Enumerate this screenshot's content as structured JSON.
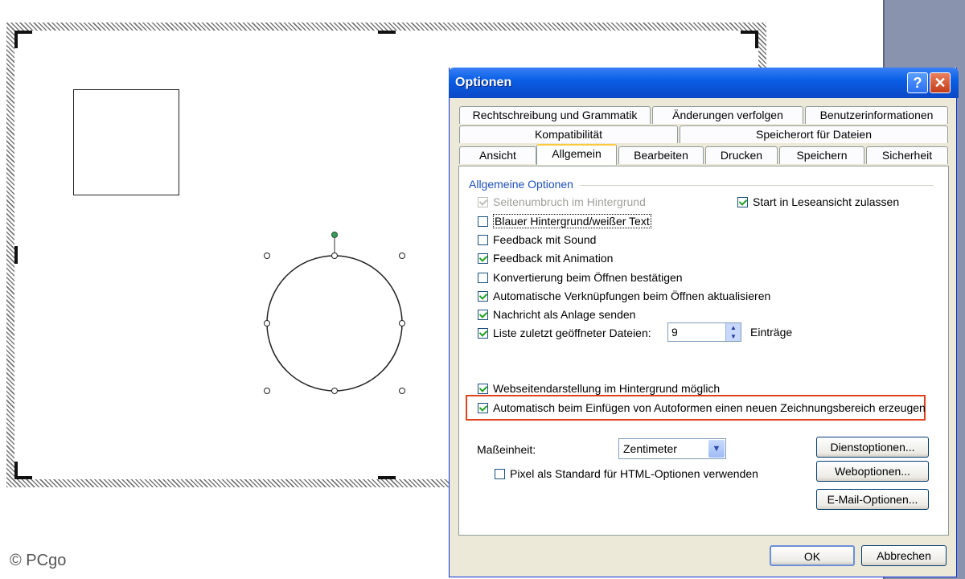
{
  "copyright": "© PCgo",
  "dialog": {
    "title": "Optionen",
    "help_glyph": "?",
    "close_glyph": "✕",
    "tabs_row1": [
      "Rechtschreibung und Grammatik",
      "Änderungen verfolgen",
      "Benutzerinformationen"
    ],
    "tabs_row2": [
      "Kompatibilität",
      "Speicherort für Dateien"
    ],
    "tabs_row3": [
      "Ansicht",
      "Allgemein",
      "Bearbeiten",
      "Drucken",
      "Speichern",
      "Sicherheit"
    ],
    "active_tab": "Allgemein",
    "group_title": "Allgemeine Optionen",
    "options": [
      {
        "label": "Seitenumbruch im Hintergrund",
        "checked": true,
        "disabled": true
      },
      {
        "label": "Blauer Hintergrund/weißer Text",
        "checked": false,
        "disabled": false
      },
      {
        "label": "Feedback mit Sound",
        "checked": false,
        "disabled": false
      },
      {
        "label": "Feedback mit Animation",
        "checked": true,
        "disabled": false
      },
      {
        "label": "Konvertierung beim Öffnen bestätigen",
        "checked": false,
        "disabled": false
      },
      {
        "label": "Automatische Verknüpfungen beim Öffnen aktualisieren",
        "checked": true,
        "disabled": false
      },
      {
        "label": "Nachricht als Anlage senden",
        "checked": true,
        "disabled": false
      },
      {
        "label": "Liste zuletzt geöffneter Dateien:",
        "checked": true,
        "disabled": false
      }
    ],
    "start_reading": {
      "label": "Start in Leseansicht zulassen",
      "checked": true
    },
    "recent_files": {
      "value": "9",
      "suffix": "Einträge"
    },
    "web_bg": {
      "label": "Webseitendarstellung im Hintergrund möglich",
      "checked": true
    },
    "auto_canvas": {
      "label": "Automatisch beim Einfügen von Autoformen einen neuen Zeichnungsbereich erzeugen",
      "checked": true
    },
    "unit_label": "Maßeinheit:",
    "unit_value": "Zentimeter",
    "pixel_html": {
      "label": "Pixel als Standard für HTML-Optionen verwenden",
      "checked": false
    },
    "buttons": {
      "service": "Dienstoptionen...",
      "web": "Weboptionen...",
      "email": "E-Mail-Optionen...",
      "ok": "OK",
      "cancel": "Abbrechen"
    }
  }
}
